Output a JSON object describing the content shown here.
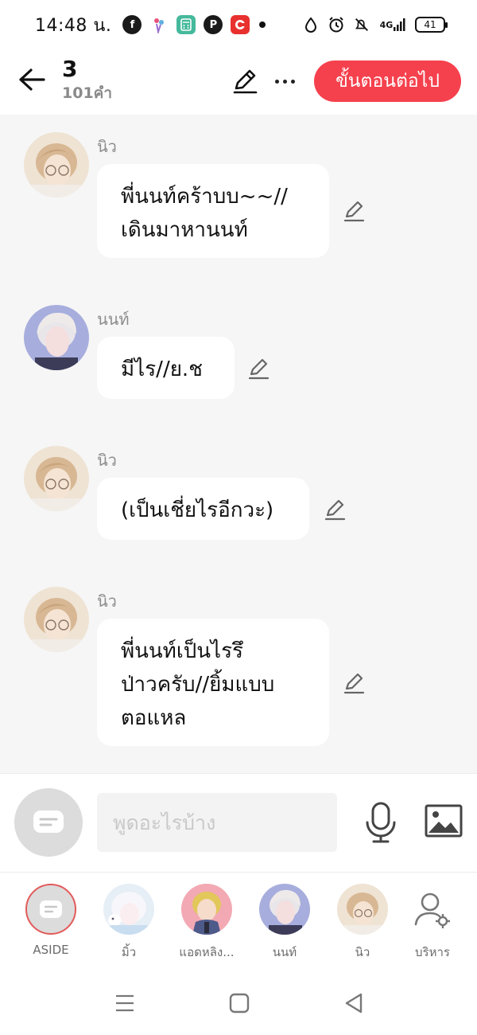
{
  "status_bar": {
    "time": "14:48 น.",
    "network": "4G",
    "battery": "41"
  },
  "header": {
    "title": "3",
    "word_count": "101คำ",
    "next_button": "ขั้นตอนต่อไป"
  },
  "messages": [
    {
      "sender": "นิว",
      "lines": [
        "พี่นนท์คร้าบบ~~//",
        "เดินมาหานนท์"
      ]
    },
    {
      "sender": "นนท์",
      "lines": [
        "มีไร//ย.ช"
      ]
    },
    {
      "sender": "นิว",
      "lines": [
        "(เป็นเชี่ยไรอีกวะ)"
      ]
    },
    {
      "sender": "นิว",
      "lines": [
        "พี่นนท์เป็นไรรึ",
        "ป่าวครับ//ยิ้มแบบ",
        "ตอแหล"
      ]
    }
  ],
  "input": {
    "placeholder": "พูดอะไรบ้าง"
  },
  "characters": [
    {
      "name": "ASIDE"
    },
    {
      "name": "มิ้ว"
    },
    {
      "name": "แอดหลิง..."
    },
    {
      "name": "นนท์"
    },
    {
      "name": "นิว"
    },
    {
      "name": "บริหาร"
    }
  ],
  "colors": {
    "accent": "#f5414d",
    "chat_bg": "#f6f6f6",
    "bubble_bg": "#ffffff",
    "muted_text": "#8c8c8c"
  },
  "icons": {
    "back": "arrow-left-icon",
    "edit": "pencil-icon",
    "more": "more-dots-icon",
    "mic": "microphone-icon",
    "image": "image-icon",
    "manage": "user-gear-icon"
  }
}
